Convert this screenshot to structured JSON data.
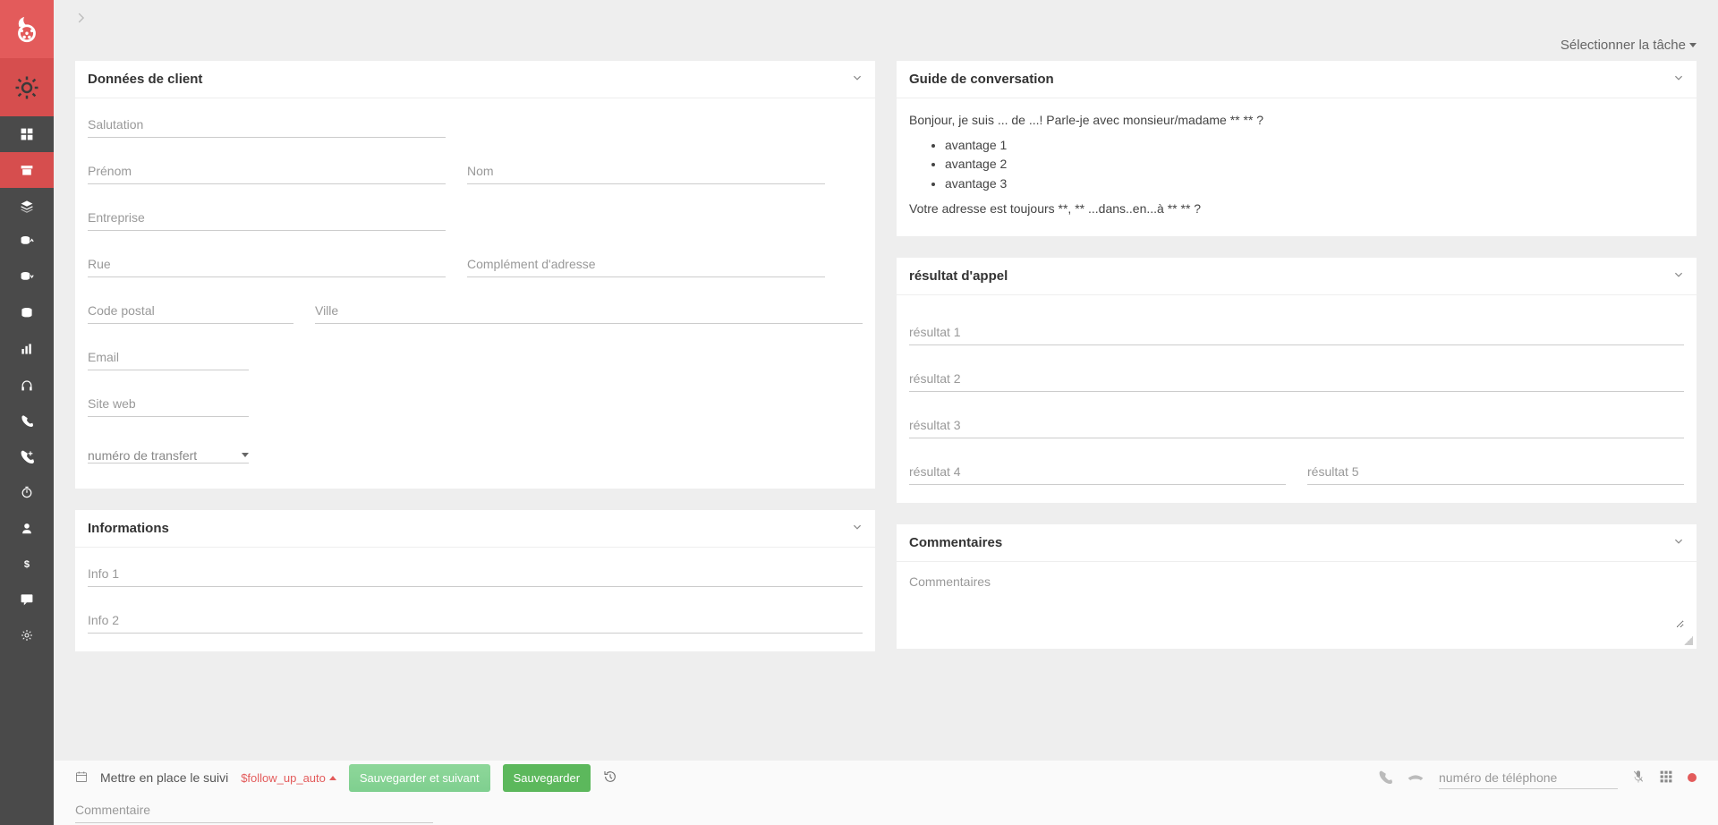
{
  "topbar": {
    "task_selector": "Sélectionner la tâche"
  },
  "panels": {
    "client": {
      "title": "Données de client"
    },
    "info": {
      "title": "Informations"
    },
    "guide": {
      "title": "Guide de conversation"
    },
    "result": {
      "title": "résultat d'appel"
    },
    "comments": {
      "title": "Commentaires"
    }
  },
  "client": {
    "salutation": "Salutation",
    "firstname": "Prénom",
    "lastname": "Nom",
    "company": "Entreprise",
    "street": "Rue",
    "addr2": "Complément d'adresse",
    "zip": "Code postal",
    "city": "Ville",
    "email": "Email",
    "website": "Site web",
    "transfer": "numéro de transfert"
  },
  "info": {
    "info1": "Info 1",
    "info2": "Info 2"
  },
  "guide": {
    "line1": "Bonjour, je suis ... de ...! Parle-je avec monsieur/madame ** ** ?",
    "adv1": "avantage 1",
    "adv2": "avantage 2",
    "adv3": "avantage 3",
    "line2": "Votre adresse est toujours **, ** ...dans..en...à ** ** ?"
  },
  "results": {
    "r1": "résultat 1",
    "r2": "résultat 2",
    "r3": "résultat 3",
    "r4": "résultat 4",
    "r5": "résultat 5"
  },
  "comments": {
    "placeholder": "Commentaires"
  },
  "footer": {
    "schedule": "Mettre en place le suivi",
    "followup": "$follow_up_auto",
    "save_next": "Sauvegarder et suivant",
    "save": "Sauvegarder",
    "phone_placeholder": "numéro de téléphone",
    "comment_placeholder": "Commentaire"
  }
}
